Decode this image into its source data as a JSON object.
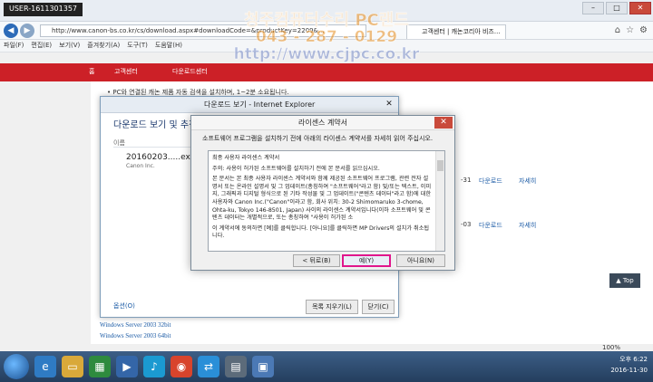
{
  "browser": {
    "pc_name": "USER-1611301357",
    "url": "http://www.canon-bs.co.kr/cs/download.aspx#downloadCode=&productKey=2209&...",
    "tab_label": "고객센터 | 캐논코리아 비즈...",
    "menus": [
      "파일(F)",
      "편집(E)",
      "보기(V)",
      "즐겨찾기(A)",
      "도구(T)",
      "도움말(H)"
    ]
  },
  "watermark": {
    "line1": "청주컴퓨터수리 PC랜드",
    "line2": "043 - 287 - 0129",
    "line3": "http://www.cjpc.co.kr"
  },
  "page": {
    "breadcrumbs": [
      "홈",
      "고객센터",
      "다운로드센터"
    ],
    "note": "• PC와 연결된 캐논 제품 자동 검색을 설치하며, 1~2분 소요됩니다.",
    "rows": [
      {
        "date": "-31",
        "download": "다운로드",
        "detail": "자세히"
      },
      {
        "date": "-03",
        "download": "다운로드",
        "detail": "자세히"
      }
    ],
    "side_links": [
      "Windows Server 2003 32bit",
      "Windows Server 2003 64bit"
    ],
    "top_button": "Top",
    "zoom": "100%"
  },
  "download_window": {
    "title": "다운로드 보기 - Internet Explorer",
    "heading": "다운로드 보기 및 추적",
    "col_name": "이름",
    "file_name": "20160203.....exe",
    "publisher": "Canon Inc.",
    "options_link": "옵션(O)",
    "clear_button": "목록 지우기(L)",
    "close_button": "닫기(C)"
  },
  "license_dialog": {
    "title": "라이센스 계약서",
    "intro": "소프트웨어 프로그램을 설치하기 전에 아래의 라이센스 계약서를 자세히 읽어 주십시오.",
    "paragraphs": [
      "최종 사용자 라이센스 계약서",
      "주의: 사용이 허가된 소프트웨어를 설치하기 전에 본 문서를 읽으십시오.",
      "본 문서는 본 최종 사용자 라이센스 계약서와 함께 제공된 소프트웨어 프로그램, 관련 전자 설명서 또는 온라인 설명서 및 그 업데이트(총칭하여 \"소프트웨어\"라고 함) 및/또는 텍스트, 이미지, 그래픽과 디지털 형식으로 된 기타 작성물 및 그 업데이트(\"콘텐츠 데이터\"라고 함)에 대한 사용자와 Canon Inc.(\"Canon\"이라고 함, 회사 위치: 30-2 Shimomaruko 3-chome, Ohta-ku, Tokyo 146-8501, Japan) 사이의 라이센스 계약서입니다(이하 소프트웨어 및 콘텐츠 데이터는 개별적으로, 또는 총칭하여 \"사용이 허가된 소",
      "이 계약서에 동의하면 [예]를 클릭합니다. [아니요]를 클릭하면 MP Drivers의 설치가 취소됩니다."
    ],
    "back_button": "< 뒤로(B)",
    "yes_button": "예(Y)",
    "no_button": "아니요(N)"
  },
  "taskbar": {
    "time": "오후 6:22",
    "date": "2016-11-30"
  }
}
